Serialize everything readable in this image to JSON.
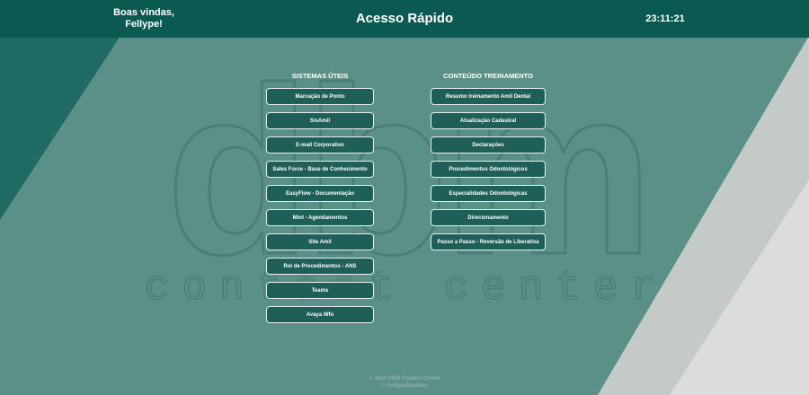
{
  "header": {
    "welcome_line1": "Boas vindas,",
    "welcome_line2": "Fellype!",
    "title": "Acesso Rápido",
    "clock": "23:11:21"
  },
  "watermark": {
    "logo_text": "dbm",
    "tagline": "contact center"
  },
  "sistemas": {
    "title": "SISTEMAS ÚTEIS",
    "items": [
      "Marcação de Ponto",
      "SisAmil",
      "E-mail Corporativo",
      "Sales Force - Base de Conhecimento",
      "EasyFlow - Documentação",
      "Mint - Agendamentos",
      "Site Amil",
      "Rol de Procedimentos - ANS",
      "Teams",
      "Avaya Wfo"
    ]
  },
  "treinamento": {
    "title": "CONTEÚDO TREINAMENTO",
    "items": [
      "Resumo treinamento Amil Dental",
      "Atualização Cadastral",
      "Declarações",
      "Procedimentos Odontológicos",
      "Especialidades Odontológicas",
      "Direcionamento",
      "Passo a Passo - Reversão de Liberativa"
    ]
  },
  "footer": {
    "line1": "© 2023 DBM Contact Center",
    "line2": "© FellypeSantates"
  },
  "colors": {
    "header": "#0b5a52",
    "background": "#5b9088",
    "button": "#1e5f57"
  }
}
